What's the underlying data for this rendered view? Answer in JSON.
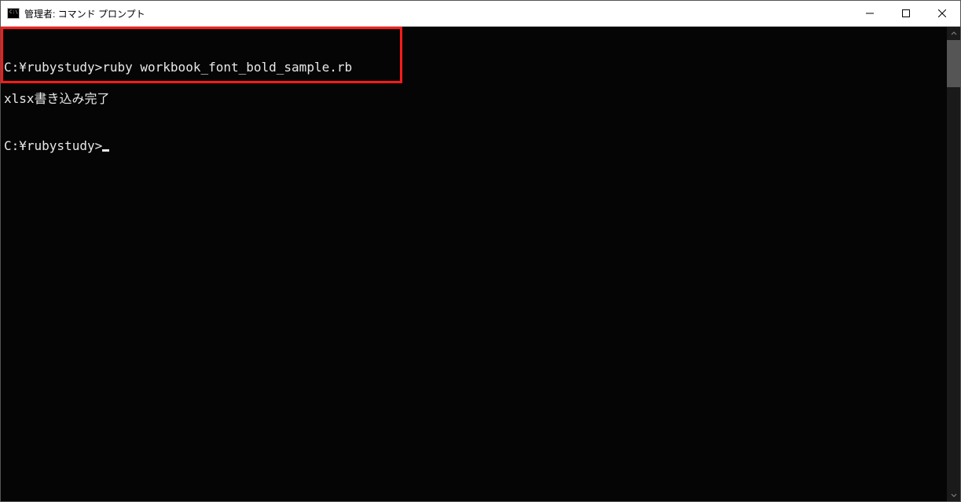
{
  "window": {
    "title": "管理者: コマンド プロンプト"
  },
  "terminal": {
    "line1": "C:¥rubystudy>ruby workbook_font_bold_sample.rb",
    "line2": "xlsx書き込み完了",
    "blank": "",
    "prompt": "C:¥rubystudy>"
  }
}
